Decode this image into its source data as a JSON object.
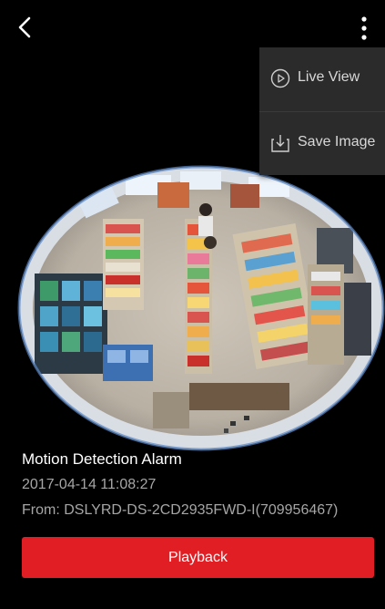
{
  "header": {
    "back_icon": "chevron-left-icon",
    "more_icon": "more-vertical-icon"
  },
  "menu": {
    "items": [
      {
        "label": "Live View",
        "icon": "play-circle-icon"
      },
      {
        "label": "Save Image",
        "icon": "download-icon"
      }
    ]
  },
  "alarm": {
    "title": "Motion Detection Alarm",
    "time": "2017-04-14 11:08:27",
    "from": "From: DSLYRD-DS-2CD2935FWD-I(709956467)"
  },
  "actions": {
    "playback_label": "Playback"
  },
  "colors": {
    "background": "#000000",
    "accent": "#e01e24",
    "menu_bg": "#2b2b2b",
    "secondary_text": "#a6a6a6"
  }
}
